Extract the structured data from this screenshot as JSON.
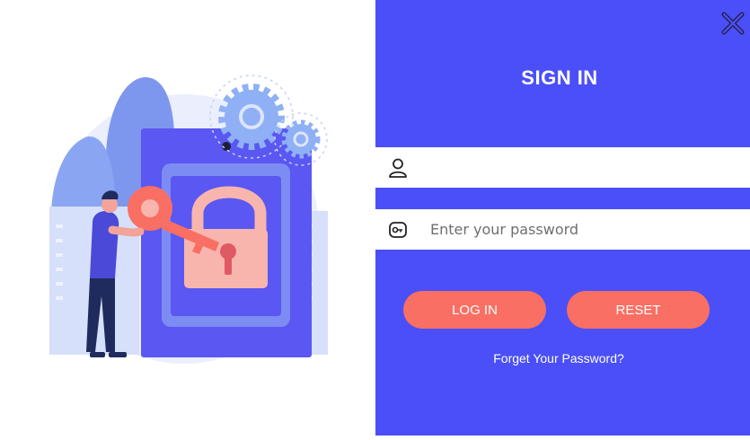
{
  "dialog": {
    "title": "SIGN IN",
    "username": {
      "icon": "user-icon",
      "value": "",
      "placeholder": ""
    },
    "password": {
      "icon": "key-icon",
      "value": "",
      "placeholder": "Enter your password"
    },
    "login_label": "LOG IN",
    "reset_label": "RESET",
    "forgot_label": "Forget Your Password?",
    "close_icon": "close-icon"
  },
  "illustration": {
    "name": "security-illustration",
    "subject": "person unlocking a padlock with a key"
  },
  "colors": {
    "panel": "#4b4ff7",
    "button": "#fa6f63",
    "text_light": "#ffffff",
    "illustration_blue": "#5a57f2",
    "illustration_pink": "#f7b5ae"
  }
}
